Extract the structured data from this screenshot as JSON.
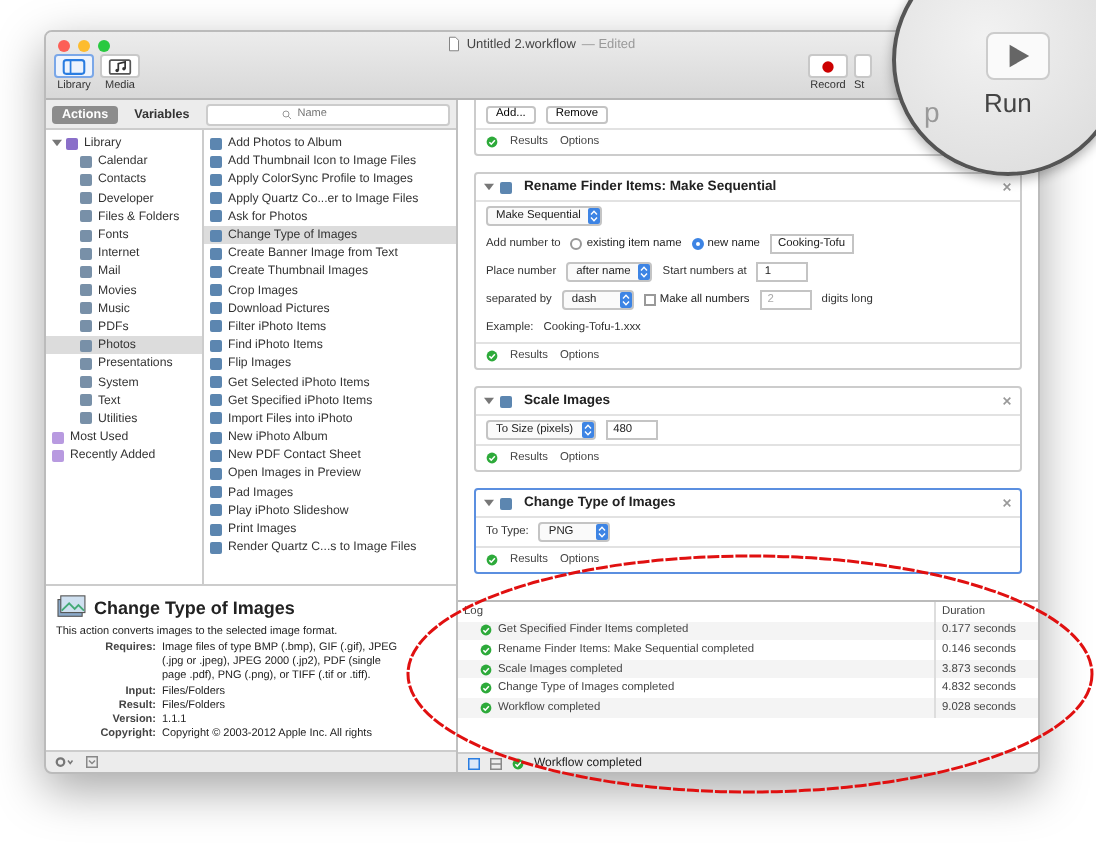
{
  "window": {
    "title": "Untitled 2.workflow",
    "status": "— Edited"
  },
  "toolbar": {
    "left": [
      {
        "label": "Library",
        "kind": "library",
        "selected": true
      },
      {
        "label": "Media",
        "kind": "media",
        "selected": false
      }
    ],
    "record": "Record",
    "stop_partial": "St",
    "magnifier": {
      "partial_label": "p",
      "run": "Run"
    }
  },
  "library": {
    "tabs": [
      {
        "label": "Actions",
        "selected": true
      },
      {
        "label": "Variables",
        "selected": false
      }
    ],
    "search": {
      "placeholder": "Name"
    },
    "categories": [
      {
        "label": "Library",
        "expanded": true,
        "selected": false,
        "children": [
          {
            "label": "Calendar",
            "selected": false
          },
          {
            "label": "Contacts",
            "selected": false
          },
          {
            "label": "Developer",
            "selected": false
          },
          {
            "label": "Files & Folders",
            "selected": false
          },
          {
            "label": "Fonts",
            "selected": false
          },
          {
            "label": "Internet",
            "selected": false
          },
          {
            "label": "Mail",
            "selected": false
          },
          {
            "label": "Movies",
            "selected": false
          },
          {
            "label": "Music",
            "selected": false
          },
          {
            "label": "PDFs",
            "selected": false
          },
          {
            "label": "Photos",
            "selected": true
          },
          {
            "label": "Presentations",
            "selected": false
          },
          {
            "label": "System",
            "selected": false
          },
          {
            "label": "Text",
            "selected": false
          },
          {
            "label": "Utilities",
            "selected": false
          }
        ]
      },
      {
        "label": "Most Used",
        "selected": false
      },
      {
        "label": "Recently Added",
        "selected": false
      }
    ],
    "actions": [
      {
        "label": "Add Photos to Album",
        "selected": false
      },
      {
        "label": "Add Thumbnail Icon to Image Files",
        "selected": false
      },
      {
        "label": "Apply ColorSync Profile to Images",
        "selected": false
      },
      {
        "label": "Apply Quartz Co...er to Image Files",
        "selected": false
      },
      {
        "label": "Ask for Photos",
        "selected": false
      },
      {
        "label": "Change Type of Images",
        "selected": true
      },
      {
        "label": "Create Banner Image from Text",
        "selected": false
      },
      {
        "label": "Create Thumbnail Images",
        "selected": false
      },
      {
        "label": "Crop Images",
        "selected": false
      },
      {
        "label": "Download Pictures",
        "selected": false
      },
      {
        "label": "Filter iPhoto Items",
        "selected": false
      },
      {
        "label": "Find iPhoto Items",
        "selected": false
      },
      {
        "label": "Flip Images",
        "selected": false
      },
      {
        "label": "Get Selected iPhoto Items",
        "selected": false
      },
      {
        "label": "Get Specified iPhoto Items",
        "selected": false
      },
      {
        "label": "Import Files into iPhoto",
        "selected": false
      },
      {
        "label": "New iPhoto Album",
        "selected": false
      },
      {
        "label": "New PDF Contact Sheet",
        "selected": false
      },
      {
        "label": "Open Images in Preview",
        "selected": false
      },
      {
        "label": "Pad Images",
        "selected": false
      },
      {
        "label": "Play iPhoto Slideshow",
        "selected": false
      },
      {
        "label": "Print Images",
        "selected": false
      },
      {
        "label": "Render Quartz C...s to Image Files",
        "selected": false
      }
    ],
    "description": {
      "title": "Change Type of Images",
      "summary": "This action converts images to the selected image format.",
      "fields": [
        {
          "label": "Requires:",
          "value": "Image files of type BMP (.bmp), GIF (.gif), JPEG (.jpg or .jpeg), JPEG 2000 (.jp2), PDF (single page .pdf), PNG (.png), or TIFF (.tif or .tiff)."
        },
        {
          "label": "Input:",
          "value": "Files/Folders"
        },
        {
          "label": "Result:",
          "value": "Files/Folders"
        },
        {
          "label": "Version:",
          "value": "1.1.1"
        },
        {
          "label": "Copyright:",
          "value": "Copyright © 2003-2012 Apple Inc.  All rights"
        }
      ]
    }
  },
  "workflow": {
    "partial_block": {
      "buttons": [
        "Add...",
        "Remove"
      ],
      "footer": [
        "Results",
        "Options"
      ]
    },
    "blocks": [
      {
        "title": "Rename Finder Items: Make Sequential",
        "selected": false,
        "rows": [
          [
            {
              "kind": "dropdown",
              "text": "Make Sequential"
            }
          ],
          [
            {
              "kind": "label",
              "text": "Add number to"
            },
            {
              "kind": "radio",
              "text": "existing item name",
              "selected": false
            },
            {
              "kind": "radio",
              "text": "new name",
              "selected": true
            },
            {
              "kind": "field",
              "text": "Cooking-Tofu"
            }
          ],
          [
            {
              "kind": "label",
              "text": "Place number"
            },
            {
              "kind": "dropdown",
              "text": "after name"
            },
            {
              "kind": "label",
              "text": "Start numbers at"
            },
            {
              "kind": "field",
              "text": "1"
            }
          ],
          [
            {
              "kind": "label",
              "text": "separated by"
            },
            {
              "kind": "dropdown",
              "text": "dash"
            },
            {
              "kind": "checkbox",
              "text": "Make all numbers",
              "checked": false
            },
            {
              "kind": "field",
              "text": "2",
              "disabled": true
            },
            {
              "kind": "label",
              "text": "digits long"
            }
          ],
          [
            {
              "kind": "label",
              "text": "Example:"
            },
            {
              "kind": "text",
              "text": "Cooking-Tofu-1.xxx"
            }
          ]
        ],
        "footer": [
          "Results",
          "Options"
        ]
      },
      {
        "title": "Scale Images",
        "selected": false,
        "rows": [
          [
            {
              "kind": "dropdown",
              "text": "To Size (pixels)"
            },
            {
              "kind": "field",
              "text": "480"
            }
          ]
        ],
        "footer": [
          "Results",
          "Options"
        ]
      },
      {
        "title": "Change Type of Images",
        "selected": true,
        "rows": [
          [
            {
              "kind": "label",
              "text": "To Type:"
            },
            {
              "kind": "dropdown",
              "text": "PNG"
            }
          ]
        ],
        "footer": [
          "Results",
          "Options"
        ]
      }
    ]
  },
  "log": {
    "columns": [
      "Log",
      "Duration"
    ],
    "rows": [
      {
        "text": "Get Specified Finder Items completed",
        "duration": "0.177 seconds"
      },
      {
        "text": "Rename Finder Items: Make Sequential completed",
        "duration": "0.146 seconds"
      },
      {
        "text": "Scale Images completed",
        "duration": "3.873 seconds"
      },
      {
        "text": "Change Type of Images completed",
        "duration": "4.832 seconds"
      },
      {
        "text": "Workflow completed",
        "duration": "9.028 seconds"
      }
    ]
  },
  "status_bar": "Workflow completed"
}
